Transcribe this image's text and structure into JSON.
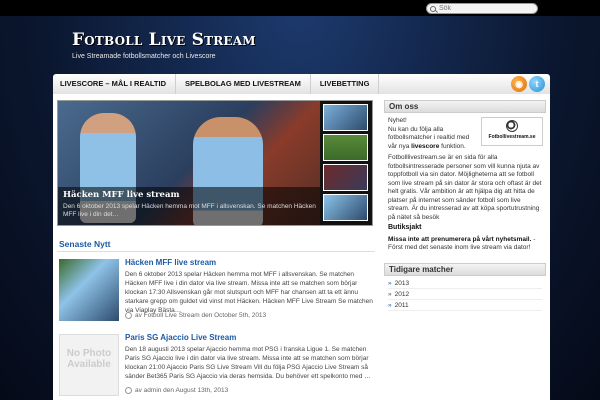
{
  "search": {
    "placeholder": "Sök"
  },
  "header": {
    "logo": "Fotboll Live Stream",
    "tagline": "Live Streamade fotbollsmatcher och Livescore"
  },
  "nav": {
    "items": [
      {
        "label": "Livescore – Mål i Realtid"
      },
      {
        "label": "Spelbolag med Livestream"
      },
      {
        "label": "Livebetting"
      }
    ],
    "social": {
      "rss": "rss-icon",
      "twitter": "twitter-icon"
    }
  },
  "featured": {
    "title": "Häcken MFF live stream",
    "text": "Den 6 oktober 2013 spelar Häcken hemma mot MFF i allsvenskan. Se matchen Häcken MFF live i din det…"
  },
  "news": {
    "heading": "Senaste Nytt",
    "posts": [
      {
        "title": "Häcken MFF live stream",
        "text": "Den 6 oktober 2013 spelar Häcken hemma mot MFF i allsvenskan. Se matchen Häcken MFF live i din dator via live stream. Missa inte att se matchen som börjar klockan 17:30 Allsvenskan går mot slutspurt och MFF har chansen att ta ett ännu starkare grepp om guldet vid vinst mot Häcken. Häcken MFF Live Stream Se matchen via Viaplay Bästa…",
        "meta": "av Fotboll Live Stream den October 5th, 2013"
      },
      {
        "title": "Paris SG Ajaccio Live Stream",
        "text": "Den 18 augusti 2013 spelar Ajaccio hemma mot PSG i franska Ligue 1. Se matchen Paris SG Ajaccio live i din dator via live stream. Missa inte att se matchen som börjar klockan 21:00 Ajaccio Paris SG Live Stream Vill du följa PSG Ajaccio Live Stream så sänder Bet365 Paris SG Ajaccio via deras hemsida. Du behöver ett spelkonto med …",
        "meta": "av admin den August 13th, 2013",
        "thumb_text": "No Photo Available"
      }
    ]
  },
  "sidebar": {
    "omoss": {
      "heading": "Om oss",
      "new": "Nyhet!",
      "intro_a": "Nu kan du följa alla fotbollsmatcher i realtid med vår nya",
      "intro_link": "livescore",
      "intro_b": "funktion.",
      "ad_label": "Fotbollivestream.se",
      "body": "Fotbolllivestream.se är en sida för alla fotbollsintresserade personer som vill kunna njuta av toppfotboll via sin dator. Möjligheterna att se fotboll som live stream på sin dator är stora och oftast är det helt gratis. Vår ambition är att hjälpa dig att hitta de platser på internet som sänder fotboll som live stream. Är du intresserad av att köpa sportutrustning på nätet så besök",
      "butiksjakt": "Butiksjakt",
      "bold_cta": "Missa inte att prenumerera på vårt nyhetsmail.",
      "cta_rest": "- Först med det senaste inom live stream via dator!"
    },
    "archive": {
      "heading": "Tidigare matcher",
      "years": [
        "2013",
        "2012",
        "2011"
      ]
    }
  }
}
